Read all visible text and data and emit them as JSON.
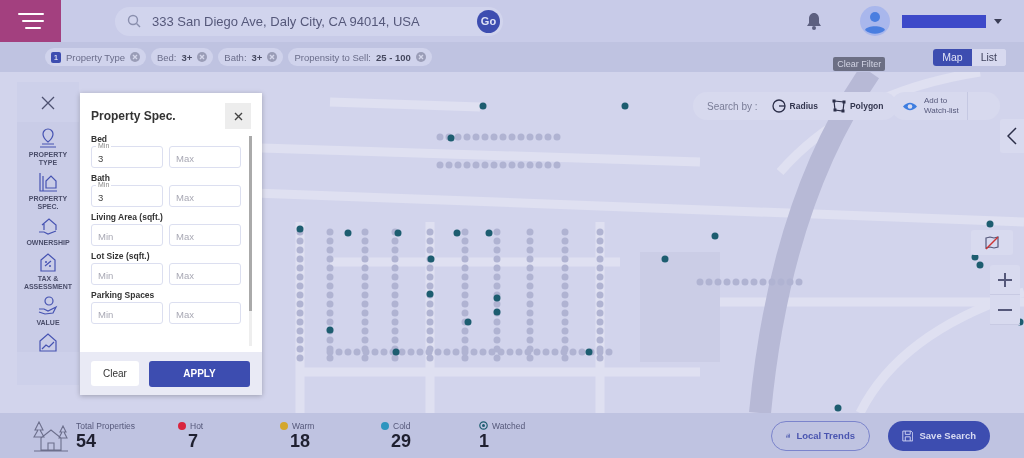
{
  "header": {
    "search": {
      "value": "333 San Diego Ave, Daly City, CA 94014, USA"
    },
    "go_button": "Go"
  },
  "filters": [
    {
      "count": "1",
      "label": "Property Type"
    },
    {
      "label": "Bed:",
      "value": "3+"
    },
    {
      "label": "Bath:",
      "value": "3+"
    },
    {
      "label": "Propensity to Sell:",
      "value": "25 - 100"
    }
  ],
  "clear_filter_tooltip": "Clear Filter",
  "view_toggle": [
    {
      "label": "Map",
      "selected": true
    },
    {
      "label": "List",
      "selected": false
    }
  ],
  "map": {
    "search_by_label": "Search by :",
    "tools": [
      {
        "kind": "radius",
        "label": "Radius"
      },
      {
        "kind": "polygon",
        "label": "Polygon"
      }
    ],
    "watchlist_button": {
      "line_1": "Add to",
      "line_2": "Watch-list"
    }
  },
  "sidebar": {
    "items": [
      {
        "kind": "type",
        "label": "PROPERTY TYPE"
      },
      {
        "kind": "spec",
        "label": "PROPERTY SPEC."
      },
      {
        "kind": "ownership",
        "label": "OWNERSHIP"
      },
      {
        "kind": "tax",
        "label": "TAX & ASSESSMENT"
      },
      {
        "kind": "value",
        "label": "VALUE"
      },
      {
        "kind": "trend"
      }
    ]
  },
  "panel": {
    "title": "Property Spec.",
    "fields": [
      {
        "label": "Bed",
        "min": {
          "floating_label": "Min",
          "value": "3"
        },
        "max": {
          "placeholder": "Max"
        }
      },
      {
        "label": "Bath",
        "min": {
          "floating_label": "Min",
          "value": "3"
        },
        "max": {
          "placeholder": "Max"
        }
      },
      {
        "label": "Living Area (sqft.)",
        "min": {
          "placeholder": "Min"
        },
        "max": {
          "placeholder": "Max"
        }
      },
      {
        "label": "Lot Size (sqft.)",
        "min": {
          "placeholder": "Min"
        },
        "max": {
          "placeholder": "Max"
        }
      },
      {
        "label": "Parking Spaces",
        "min": {
          "placeholder": "Min"
        },
        "max": {
          "placeholder": "Max"
        }
      }
    ],
    "clear_button": "Clear",
    "apply_button": "APPLY"
  },
  "stats": [
    {
      "kind": "total",
      "label": "Total Properties",
      "value": "54"
    },
    {
      "kind": "dot",
      "label": "Hot",
      "value": "7",
      "color": "#d9253f"
    },
    {
      "kind": "dot",
      "label": "Warm",
      "value": "18",
      "color": "#d4a72c"
    },
    {
      "kind": "dot",
      "label": "Cold",
      "value": "29",
      "color": "#2e95bf"
    },
    {
      "kind": "watched",
      "label": "Watched",
      "value": "1"
    }
  ],
  "actions": [
    {
      "kind": "outline",
      "label": "Local Trends"
    },
    {
      "kind": "filled",
      "label": "Save Search"
    }
  ]
}
